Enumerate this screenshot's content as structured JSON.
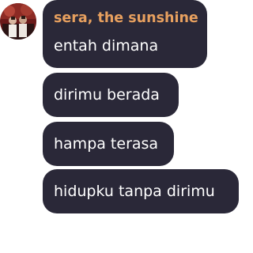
{
  "sender": {
    "name": "sera, the sunshine",
    "name_color": "#e7a05f"
  },
  "avatar": {
    "icon": "profile-photo"
  },
  "bubble_color": "#2a2838",
  "messages": [
    {
      "text": "entah dimana"
    },
    {
      "text": "dirimu berada"
    },
    {
      "text": "hampa terasa"
    },
    {
      "text": "hidupku tanpa dirimu"
    }
  ]
}
